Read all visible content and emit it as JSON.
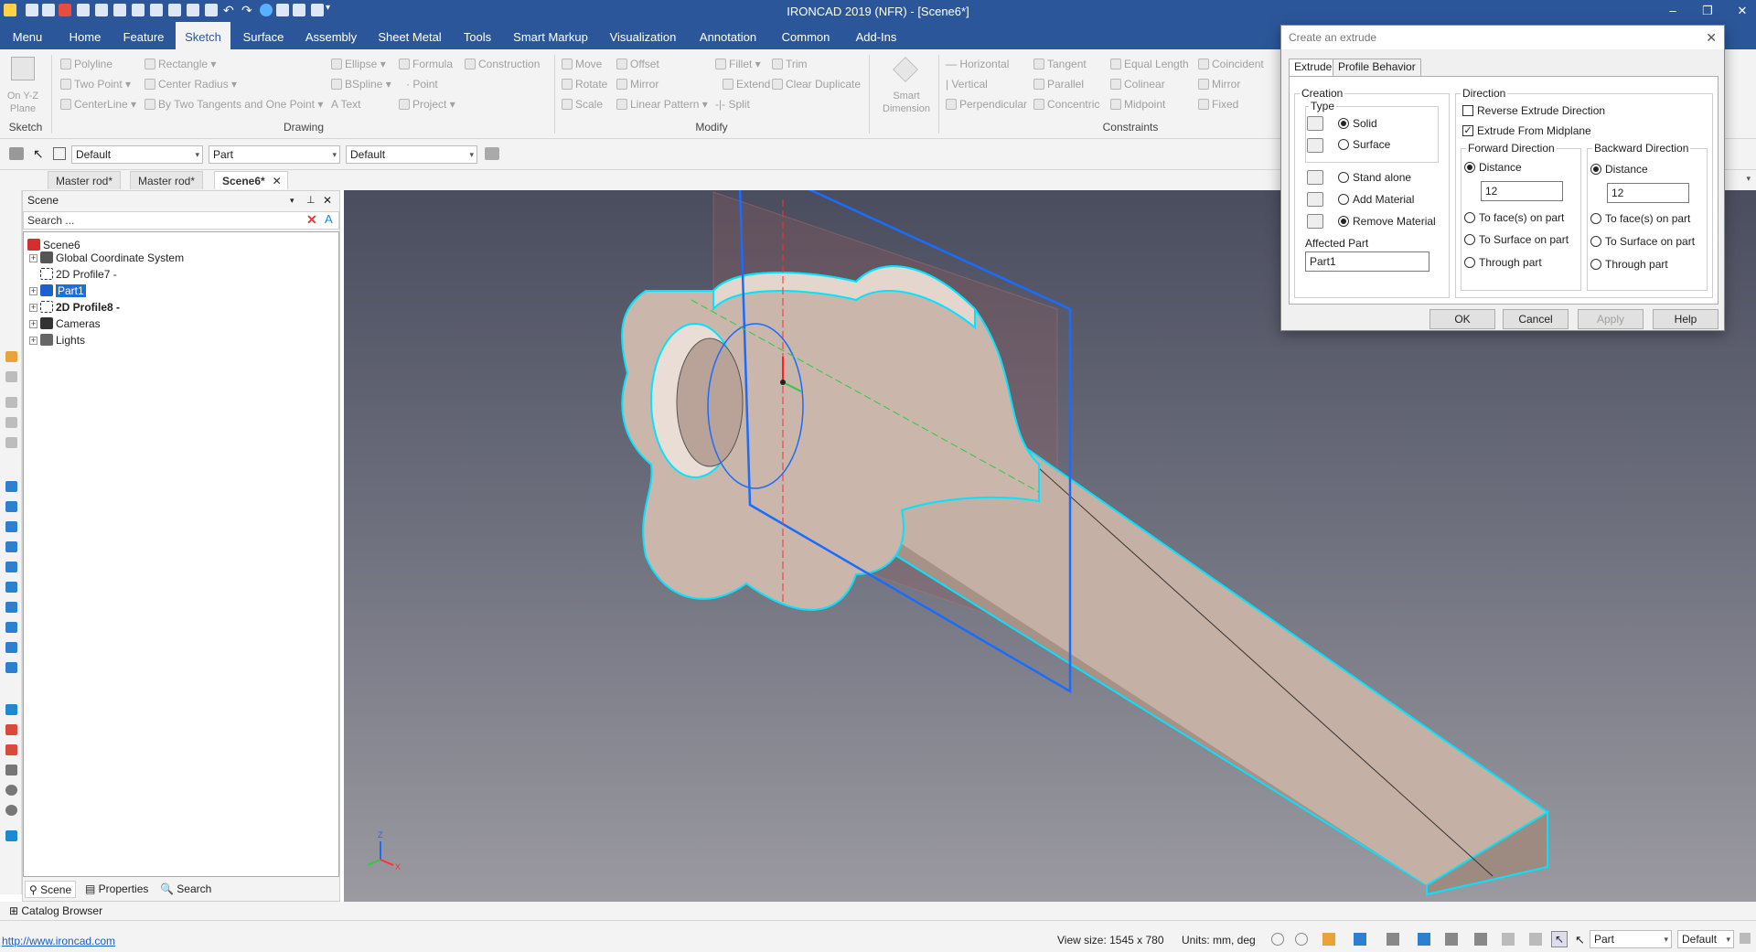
{
  "window": {
    "title": "IRONCAD 2019 (NFR) - [Scene6*]"
  },
  "menu_tabs": [
    "Menu",
    "Home",
    "Feature",
    "Sketch",
    "Surface",
    "Assembly",
    "Sheet Metal",
    "Tools",
    "Smart Markup",
    "Visualization",
    "Annotation",
    "Common",
    "Add-Ins"
  ],
  "active_menu_tab": "Sketch",
  "ribbon": {
    "sketch_group": {
      "label": "Sketch",
      "plane_button": "On Y-Z Plane"
    },
    "drawing": {
      "label": "Drawing",
      "items": [
        "Polyline",
        "Rectangle",
        "Ellipse",
        "Formula",
        "Construction",
        "Two Point",
        "Center Radius",
        "BSpline",
        "Point",
        "CenterLine",
        "By Two Tangents and One Point",
        "Text",
        "Project"
      ]
    },
    "modify": {
      "label": "Modify",
      "items": [
        "Move",
        "Offset",
        "Fillet",
        "Trim",
        "Rotate",
        "Mirror",
        "Extend",
        "Clear Duplicate",
        "Scale",
        "Linear Pattern",
        "Split"
      ]
    },
    "smart_dimension": "Smart Dimension",
    "constraints": {
      "label": "Constraints",
      "items": [
        "Horizontal",
        "Tangent",
        "Equal Length",
        "Coincident",
        "Vertical",
        "Parallel",
        "Colinear",
        "Mirror",
        "Perpendicular",
        "Concentric",
        "Midpoint",
        "Fixed"
      ]
    }
  },
  "toolbar2": {
    "combo1": "Default",
    "combo2": "Part",
    "combo3": "Default"
  },
  "doc_tabs": [
    "Master rod*",
    "Master rod*",
    "Scene6*"
  ],
  "active_doc_tab": "Scene6*",
  "scene_panel": {
    "header": "Scene",
    "search_placeholder": "Search ...",
    "tree": [
      {
        "label": "Scene6",
        "level": 0
      },
      {
        "label": "Global Coordinate System",
        "level": 1
      },
      {
        "label": "2D Profile7 -",
        "level": 1
      },
      {
        "label": "Part1",
        "level": 1,
        "selected": true
      },
      {
        "label": "2D Profile8 -",
        "level": 1,
        "bold": true
      },
      {
        "label": "Cameras",
        "level": 1
      },
      {
        "label": "Lights",
        "level": 1
      }
    ],
    "bottom_tabs": [
      "Scene",
      "Properties",
      "Search"
    ]
  },
  "catalog_browser": "Catalog Browser",
  "status": {
    "url": "http://www.ironcad.com",
    "view_size": "View size: 1545 x 780",
    "units": "Units: mm, deg",
    "combo_part": "Part",
    "combo_default": "Default"
  },
  "dialog": {
    "title": "Create an extrude",
    "tabs": [
      "Extrude",
      "Profile Behavior"
    ],
    "creation_label": "Creation",
    "type_label": "Type",
    "type_options": [
      "Solid",
      "Surface"
    ],
    "type_selected": "Solid",
    "material_options": [
      "Stand alone",
      "Add Material",
      "Remove Material"
    ],
    "material_selected": "Remove Material",
    "affected_part_label": "Affected Part",
    "affected_part": "Part1",
    "direction_label": "Direction",
    "reverse_label": "Reverse Extrude Direction",
    "reverse_checked": false,
    "midplane_label": "Extrude From Midplane",
    "midplane_checked": true,
    "forward": {
      "label": "Forward Direction",
      "options": [
        "Distance",
        "To face(s) on part",
        "To Surface on part",
        "Through part"
      ],
      "selected": "Distance",
      "distance": "12"
    },
    "backward": {
      "label": "Backward Direction",
      "options": [
        "Distance",
        "To face(s) on part",
        "To Surface on part",
        "Through part"
      ],
      "selected": "Distance",
      "distance": "12"
    },
    "buttons": {
      "ok": "OK",
      "cancel": "Cancel",
      "apply": "Apply",
      "help": "Help"
    }
  },
  "axis_labels": {
    "z": "Z",
    "x": "X"
  },
  "colors": {
    "title_bar": "#2b579a",
    "selection": "#00e5ff",
    "sketch_blue": "#1a6cff",
    "part": "#c9b6ab"
  }
}
